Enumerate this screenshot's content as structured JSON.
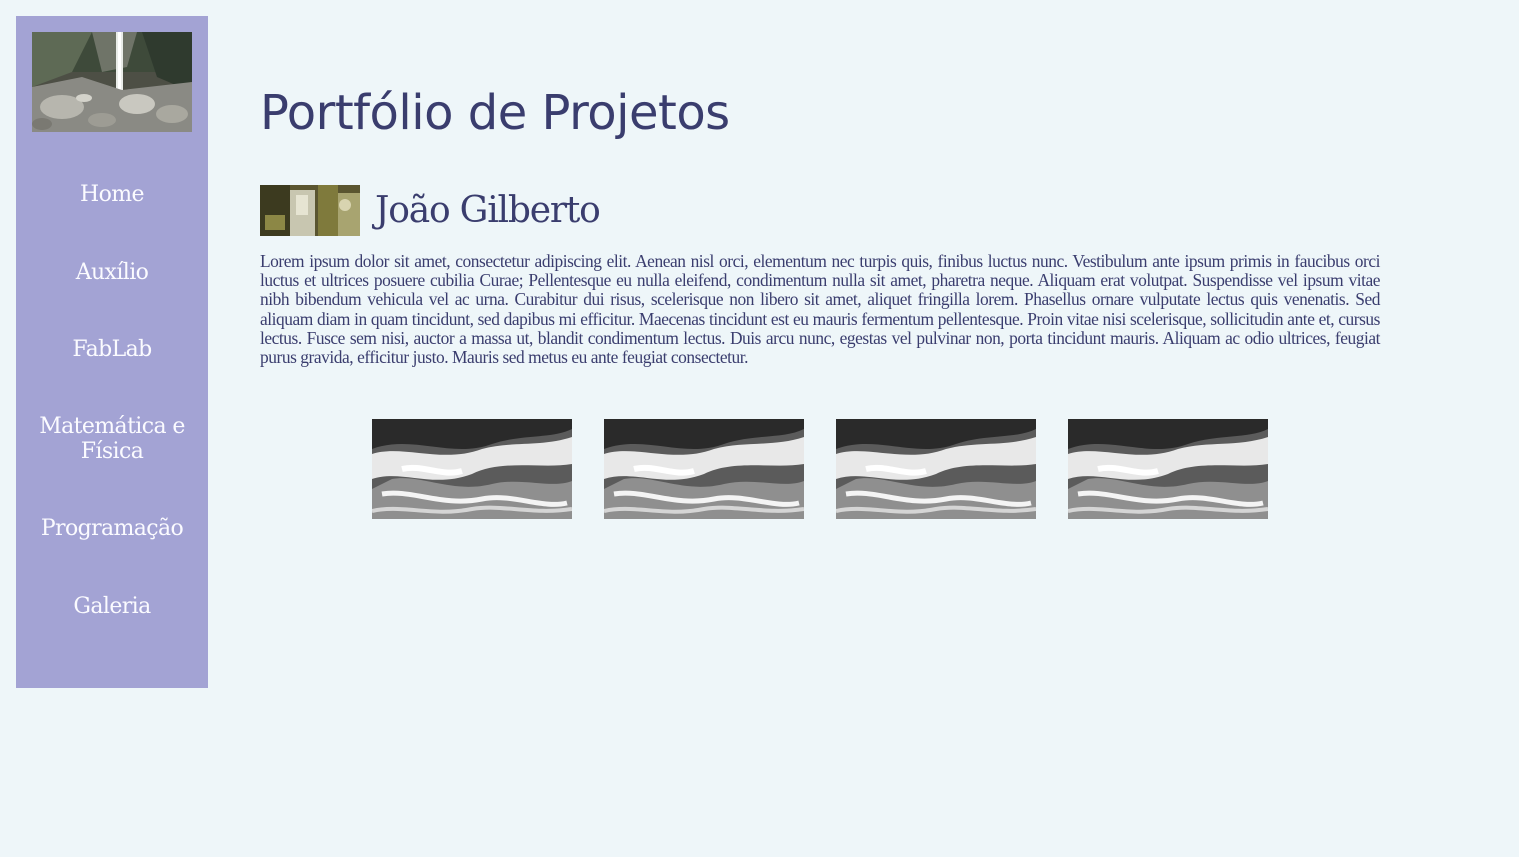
{
  "sidebar": {
    "logo": "waterfall-photo",
    "items": [
      {
        "label": "Home"
      },
      {
        "label": "Auxílio"
      },
      {
        "label": "FabLab"
      },
      {
        "label": "Matemática e Física"
      },
      {
        "label": "Programação"
      },
      {
        "label": "Galeria"
      }
    ]
  },
  "page": {
    "title": "Portfólio de Projetos"
  },
  "project": {
    "thumb": "project-photo",
    "name": "João Gilberto",
    "description": "Lorem ipsum dolor sit amet, consectetur adipiscing elit. Aenean nisl orci, elementum nec turpis quis, finibus luctus nunc. Vestibulum ante ipsum primis in faucibus orci luctus et ultrices posuere cubilia Curae; Pellentesque eu nulla eleifend, condimentum nulla sit amet, pharetra neque. Aliquam erat volutpat. Suspendisse vel ipsum vitae nibh bibendum vehicula vel ac urna. Curabitur dui risus, scelerisque non libero sit amet, aliquet fringilla lorem. Phasellus ornare vulputate lectus quis venenatis. Sed aliquam diam in quam tincidunt, sed dapibus mi efficitur. Maecenas tincidunt est eu mauris fermentum pellentesque. Proin vitae nisi scelerisque, sollicitudin ante et, cursus lectus. Fusce sem nisi, auctor a massa ut, blandit condimentum lectus. Duis arcu nunc, egestas vel pulvinar non, porta tincidunt mauris. Aliquam ac odio ultrices, feugiat purus gravida, efficitur justo. Mauris sed metus eu ante feugiat consectetur.",
    "gallery": [
      "wave-photo",
      "wave-photo",
      "wave-photo",
      "wave-photo"
    ]
  },
  "colors": {
    "background": "#eef6f9",
    "sidebar": "#a3a3d4",
    "nav_text": "#fbfbff",
    "text": "#3a3d6e"
  }
}
